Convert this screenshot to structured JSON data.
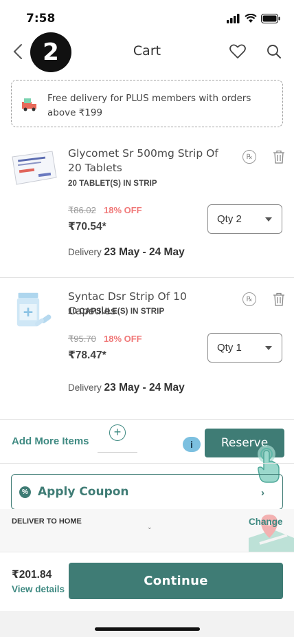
{
  "status_bar": {
    "time": "7:58"
  },
  "header": {
    "title": "Cart",
    "step_number": "2"
  },
  "banner": {
    "text": "Free delivery for PLUS members with orders above ₹199"
  },
  "cart_items": [
    {
      "name": "Glycomet Sr 500mg Strip Of 20 Tablets",
      "pack": "20 TABLET(S) IN STRIP",
      "mrp": "₹86.02",
      "discount": "18% OFF",
      "price": "₹70.54*",
      "qty": "Qty 2",
      "delivery_prefix": "Delivery",
      "delivery_dates": "23 May - 24 May",
      "rx_label": "℞"
    },
    {
      "name": "Syntac Dsr Strip Of 10 Capsules",
      "pack": "10 CAPSULE(S) IN STRIP",
      "mrp": "₹95.70",
      "discount": "18% OFF",
      "price": "₹78.47*",
      "qty": "Qty 1",
      "delivery_prefix": "Delivery",
      "delivery_dates": "23 May - 24 May",
      "rx_label": "℞"
    }
  ],
  "actions": {
    "add_more": "Add More Items",
    "plus": "+",
    "info": "i",
    "reserve": "Reserve"
  },
  "coupon": {
    "icon": "%",
    "label": "Apply Coupon",
    "arrow": "›"
  },
  "delivery_panel": {
    "title": "DELIVER TO HOME",
    "change": "Change"
  },
  "footer": {
    "total": "₹201.84",
    "view_details": "View details",
    "continue": "Continue"
  },
  "colors": {
    "accent": "#3f7c75",
    "link": "#3f8a82",
    "discount": "#f07878"
  }
}
